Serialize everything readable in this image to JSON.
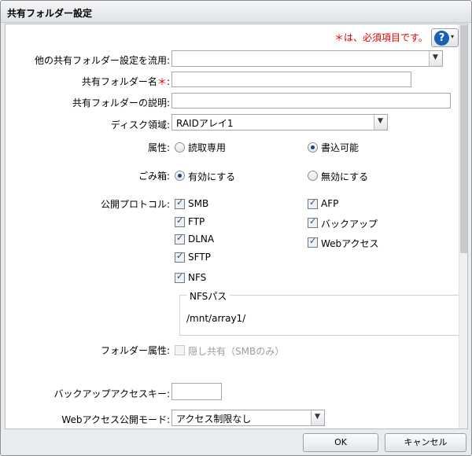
{
  "dialog": {
    "title": "共有フォルダー設定"
  },
  "notice": "＊は、必須項目です。",
  "help": {
    "symbol": "?",
    "caret": "▾",
    "icon": "help-icon"
  },
  "form": {
    "copy_label": "他の共有フォルダー設定を流用:",
    "copy_value": "",
    "name_label": "共有フォルダー名",
    "name_star": "＊",
    "name_colon": ":",
    "name_value": "",
    "desc_label": "共有フォルダーの説明:",
    "desc_value": "",
    "disk_label": "ディスク領域:",
    "disk_value": "RAIDアレイ1",
    "attr_label": "属性:",
    "attr_options": [
      {
        "label": "読取専用",
        "selected": false
      },
      {
        "label": "書込可能",
        "selected": true
      }
    ],
    "trash_label": "ごみ箱:",
    "trash_options": [
      {
        "label": "有効にする",
        "selected": true
      },
      {
        "label": "無効にする",
        "selected": false
      }
    ],
    "protocol_label": "公開プロトコル:",
    "protocols_left": [
      {
        "label": "SMB",
        "checked": true
      },
      {
        "label": "FTP",
        "checked": true
      },
      {
        "label": "DLNA",
        "checked": true
      },
      {
        "label": "SFTP",
        "checked": true
      },
      {
        "label": "NFS",
        "checked": true
      }
    ],
    "protocols_right": [
      {
        "label": "AFP",
        "checked": true
      },
      {
        "label": "バックアップ",
        "checked": true
      },
      {
        "label": "Webアクセス",
        "checked": true
      }
    ],
    "nfs_legend": "NFSパス",
    "nfs_path": "/mnt/array1/",
    "folder_attr_label": "フォルダー属性:",
    "hidden_share_label": "隠し共有（SMBのみ）",
    "backup_key_label": "バックアップアクセスキー:",
    "backup_key_value": "",
    "web_mode_label": "Webアクセス公開モード:",
    "web_mode_value": "アクセス制限なし"
  },
  "footer": {
    "ok": "OK",
    "cancel": "キャンセル"
  },
  "colors": {
    "required": "#e00000",
    "help": "#1b5fb3"
  }
}
